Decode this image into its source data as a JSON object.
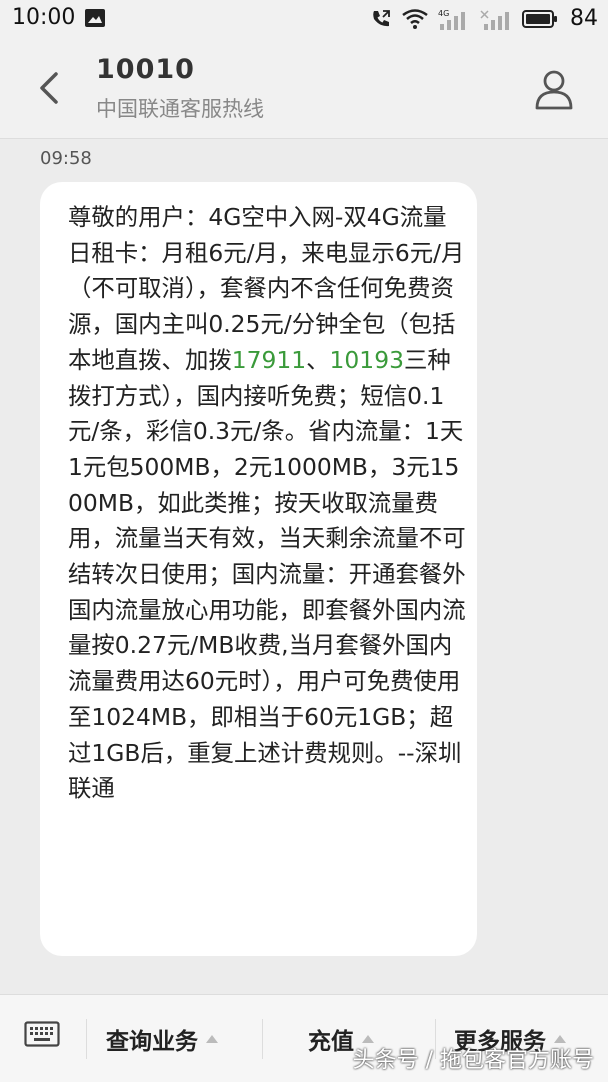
{
  "status_bar": {
    "time": "10:00",
    "battery": "84",
    "icons": [
      "image-notification-icon",
      "call-forward-icon",
      "wifi-icon",
      "signal-4g-icon",
      "signal-icon",
      "battery-icon"
    ]
  },
  "header": {
    "title": "10010",
    "subtitle": "中国联通客服热线"
  },
  "message": {
    "time": "09:58",
    "text_before": "尊敬的用户：4G空中入网-双4G流量日租卡：月租6元/月，来电显示6元/月（不可取消），套餐内不含任何免费资源，国内主叫0.25元/分钟全包（包括本地直拨、加拨",
    "number_1": "17911",
    "separator": "、",
    "number_2": "10193",
    "text_after": "三种拨打方式），国内接听免费；短信0.1元/条，彩信0.3元/条。省内流量：1天1元包500MB，2元1000MB，3元1500MB，如此类推；按天收取流量费用，流量当天有效，当天剩余流量不可结转次日使用；国内流量：开通套餐外国内流量放心用功能，即套餐外国内流量按0.27元/MB收费,当月套餐外国内流量费用达60元时），用户可免费使用至1024MB，即相当于60元1GB；超过1GB后，重复上述计费规则。--深圳联通",
    "link_color": "#3a9a3a"
  },
  "bottom_bar": {
    "menu_1": "查询业务",
    "menu_2": "充值",
    "menu_3": "更多服务"
  },
  "watermark": "头条号 / 拖包客官方账号"
}
